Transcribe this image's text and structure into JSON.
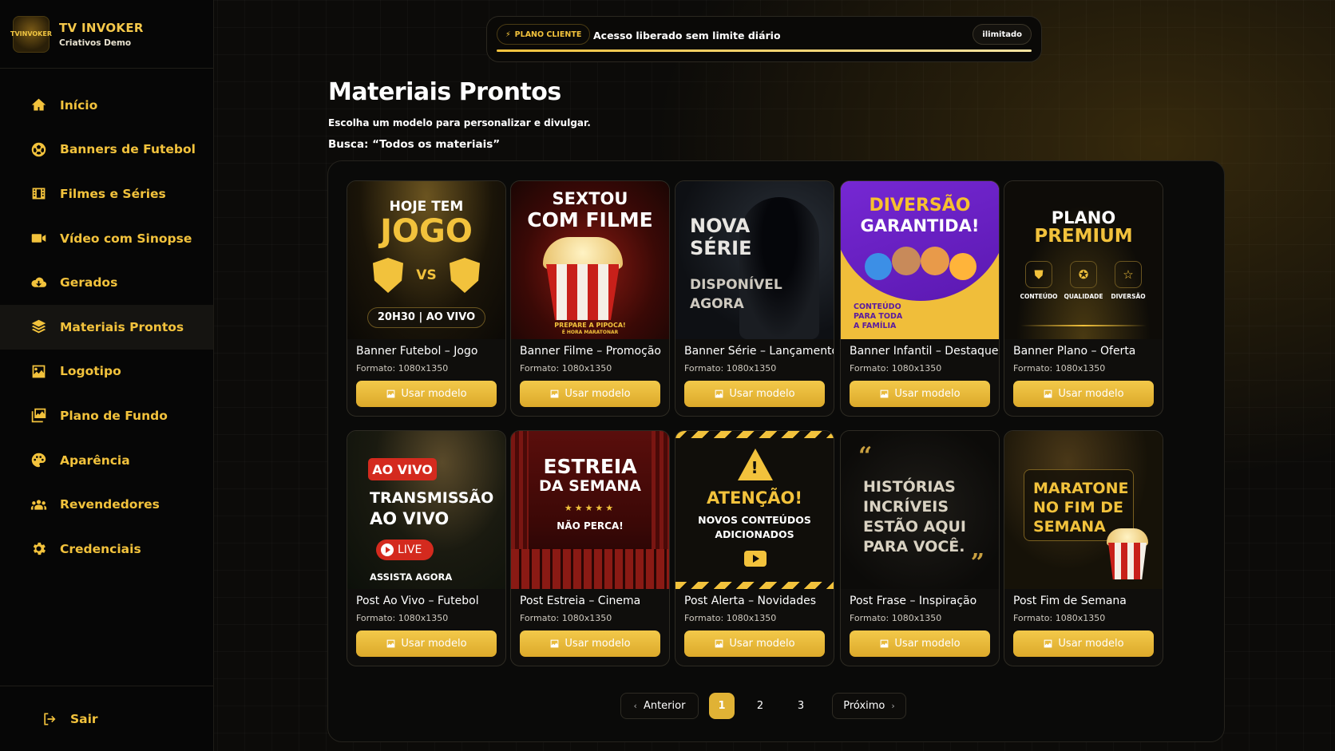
{
  "brand": {
    "title": "TV INVOKER",
    "subtitle": "Criativos Demo",
    "logo_text": "TVINVOKER"
  },
  "nav": [
    {
      "label": "Início",
      "icon": "home-icon"
    },
    {
      "label": "Banners de Futebol",
      "icon": "soccer-ball-icon"
    },
    {
      "label": "Filmes e Séries",
      "icon": "film-icon"
    },
    {
      "label": "Vídeo com Sinopse",
      "icon": "video-camera-icon"
    },
    {
      "label": "Gerados",
      "icon": "cloud-download-icon"
    },
    {
      "label": "Materiais Prontos",
      "icon": "layers-icon",
      "active": true
    },
    {
      "label": "Logotipo",
      "icon": "image-icon"
    },
    {
      "label": "Plano de Fundo",
      "icon": "images-icon"
    },
    {
      "label": "Aparência",
      "icon": "palette-icon"
    },
    {
      "label": "Revendedores",
      "icon": "users-icon"
    },
    {
      "label": "Credenciais",
      "icon": "gear-icon"
    }
  ],
  "logout_label": "Sair",
  "plan": {
    "badge": "PLANO CLIENTE",
    "text": "Acesso liberado sem limite diário",
    "pill": "ilimitado"
  },
  "page": {
    "title": "Materiais Prontos",
    "subtitle": "Escolha um modelo para personalizar e divulgar.",
    "search": "Busca: “Todos os materiais”"
  },
  "button_label": "Usar modelo",
  "cards": [
    {
      "title": "Banner Futebol – Jogo",
      "format": "Formato: 1080x1350",
      "art": {
        "line1": "HOJE TEM",
        "line2": "JOGO",
        "vs": "VS",
        "time": "20H30 | AO VIVO"
      }
    },
    {
      "title": "Banner Filme – Promoção",
      "format": "Formato: 1080x1350",
      "art": {
        "line1": "SEXTOU",
        "line2": "COM FILME",
        "foot1": "PREPARE A PIPOCA!",
        "foot2": "É HORA MARATONAR"
      }
    },
    {
      "title": "Banner Série – Lançamento",
      "format": "Formato: 1080x1350",
      "art": {
        "line1": "NOVA",
        "line2": "SÉRIE",
        "line3": "DISPONÍVEL",
        "line4": "AGORA"
      }
    },
    {
      "title": "Banner Infantil – Destaque",
      "format": "Formato: 1080x1350",
      "art": {
        "line1": "DIVERSÃO",
        "line2": "GARANTIDA!",
        "foot1": "CONTEÚDO",
        "foot2": "PARA TODA",
        "foot3": "A FAMÍLIA"
      }
    },
    {
      "title": "Banner Plano – Oferta",
      "format": "Formato: 1080x1350",
      "art": {
        "line1": "PLANO",
        "line2": "PREMIUM",
        "f1": "CONTEÚDO",
        "f2": "QUALIDADE",
        "f3": "DIVERSÃO"
      }
    },
    {
      "title": "Post Ao Vivo – Futebol",
      "format": "Formato: 1080x1350",
      "art": {
        "badge": "AO VIVO",
        "line1": "TRANSMISSÃO",
        "line2": "AO VIVO",
        "live": "LIVE",
        "foot": "ASSISTA AGORA"
      }
    },
    {
      "title": "Post Estreia – Cinema",
      "format": "Formato: 1080x1350",
      "art": {
        "line1": "ESTREIA",
        "line2": "DA SEMANA",
        "stars": "★★★★★",
        "foot": "NÃO PERCA!"
      }
    },
    {
      "title": "Post Alerta – Novidades",
      "format": "Formato: 1080x1350",
      "art": {
        "line1": "ATENÇÃO!",
        "line2": "NOVOS CONTEÚDOS",
        "line3": "ADICIONADOS"
      }
    },
    {
      "title": "Post Frase – Inspiração",
      "format": "Formato: 1080x1350",
      "art": {
        "line1": "HISTÓRIAS",
        "line2": "INCRÍVEIS",
        "line3": "ESTÃO AQUI",
        "line4": "PARA VOCÊ."
      }
    },
    {
      "title": "Post Fim de Semana",
      "format": "Formato: 1080x1350",
      "art": {
        "line1": "MARATONE",
        "line2": "NO FIM DE",
        "line3": "SEMANA"
      }
    }
  ],
  "pagination": {
    "prev": "Anterior",
    "pages": [
      "1",
      "2",
      "3"
    ],
    "current": "1",
    "next": "Próximo"
  },
  "colors": {
    "accent": "#f2c23c",
    "background": "#0c0b09",
    "button": "#e0b235"
  }
}
